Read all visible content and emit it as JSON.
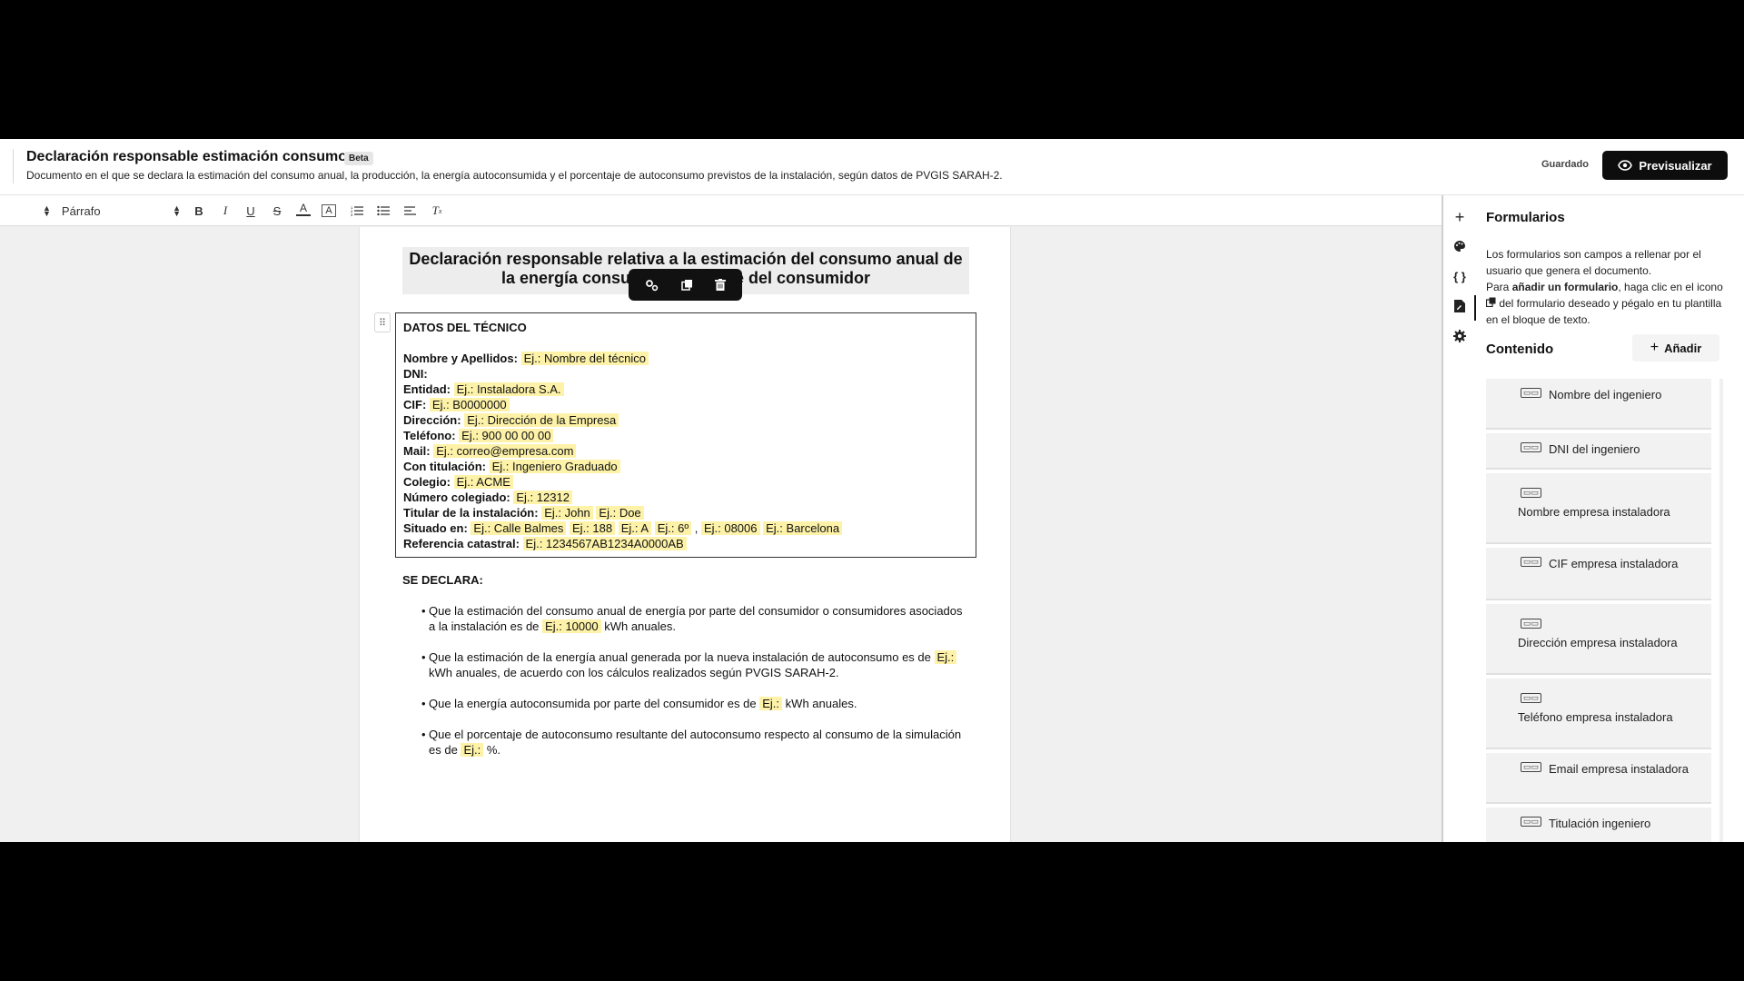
{
  "header": {
    "title": "Declaración responsable estimación consumo",
    "badge": "Beta",
    "description": "Documento en el que se declara la estimación del consumo anual, la producción, la energía autoconsumida y el porcentaje de autoconsumo previstos de la instalación, según datos de PVGIS SARAH-2.",
    "saved_status": "Guardado",
    "preview_label": "Previsualizar"
  },
  "toolbar": {
    "style_value": "Párrafo",
    "buttons": [
      "bold",
      "italic",
      "underline",
      "strikethrough",
      "text-color",
      "highlight",
      "ordered-list",
      "bullet-list",
      "align-left",
      "clear-format"
    ]
  },
  "document": {
    "heading": "Declaración responsable relativa a la estimación del consumo anual de la energía consumida por parte del consumidor",
    "tech_section_title": "DATOS DEL TÉCNICO",
    "tech_fields": [
      {
        "label": "Nombre y Apellidos:",
        "values": [
          "Ej.: Nombre del técnico"
        ]
      },
      {
        "label": "DNI:",
        "values": []
      },
      {
        "label": "Entidad:",
        "values": [
          "Ej.: Instaladora S.A."
        ]
      },
      {
        "label": "CIF:",
        "values": [
          "Ej.: B0000000"
        ]
      },
      {
        "label": "Dirección:",
        "values": [
          "Ej.: Dirección de la Empresa"
        ]
      },
      {
        "label": "Teléfono:",
        "values": [
          "Ej.: 900 00 00 00"
        ]
      },
      {
        "label": "Mail:",
        "values": [
          "Ej.: correo@empresa.com"
        ]
      },
      {
        "label": "Con titulación:",
        "values": [
          "Ej.: Ingeniero Graduado"
        ]
      },
      {
        "label": "Colegio:",
        "values": [
          "Ej.: ACME"
        ]
      },
      {
        "label": "Número colegiado:",
        "values": [
          "Ej.: 12312"
        ]
      },
      {
        "label": "Titular de la instalación:",
        "values": [
          "Ej.: John",
          "Ej.: Doe"
        ]
      },
      {
        "label": "Situado en:",
        "values": [
          "Ej.: Calle Balmes",
          "Ej.: 188",
          "Ej.: A",
          "Ej.: 6º",
          ", ",
          "Ej.: 08006",
          "Ej.: Barcelona"
        ]
      },
      {
        "label": "Referencia catastral:",
        "values": [
          "Ej.: 1234567AB1234A0000AB"
        ]
      }
    ],
    "declara_title": "SE DECLARA:",
    "bullets": {
      "b1_pre": "Que la estimación del consumo anual de energía por parte del consumidor o consumidores asociados a la instalación es de",
      "b1_field": "Ej.: 10000",
      "b1_post": "kWh anuales.",
      "b2_pre": "Que la estimación de la energía anual generada por la nueva instalación de autoconsumo es de",
      "b2_field": "Ej.:",
      "b2_post": "kWh anuales, de acuerdo con los cálculos realizados según PVGIS SARAH-2.",
      "b3_pre": "Que la energía autoconsumida por parte del consumidor es de",
      "b3_field": "Ej.:",
      "b3_post": "kWh anuales.",
      "b4_pre": "Que el porcentaje de autoconsumo resultante del autoconsumo respecto al consumo de la simulación es de",
      "b4_field": "Ej.:",
      "b4_post": "%."
    }
  },
  "panel": {
    "title": "Formularios",
    "desc_1": "Los formularios son campos a rellenar por el usuario que genera el documento.",
    "desc_2_pre": "Para ",
    "desc_2_bold": "añadir un formulario",
    "desc_2_mid": ", haga clic en el icono ",
    "desc_2_post": " del formulario deseado y pégalo en tu plantilla en el bloque de texto.",
    "content_title": "Contenido",
    "add_label": "Añadir",
    "forms": [
      {
        "label": "Nombre del ingeniero"
      },
      {
        "label": "DNI del ingeniero"
      },
      {
        "label": "Nombre empresa instaladora"
      },
      {
        "label": "CIF empresa instaladora"
      },
      {
        "label": "Dirección empresa instaladora"
      },
      {
        "label": "Teléfono empresa instaladora"
      },
      {
        "label": "Email empresa instaladora"
      },
      {
        "label": "Titulación ingeniero"
      }
    ]
  }
}
